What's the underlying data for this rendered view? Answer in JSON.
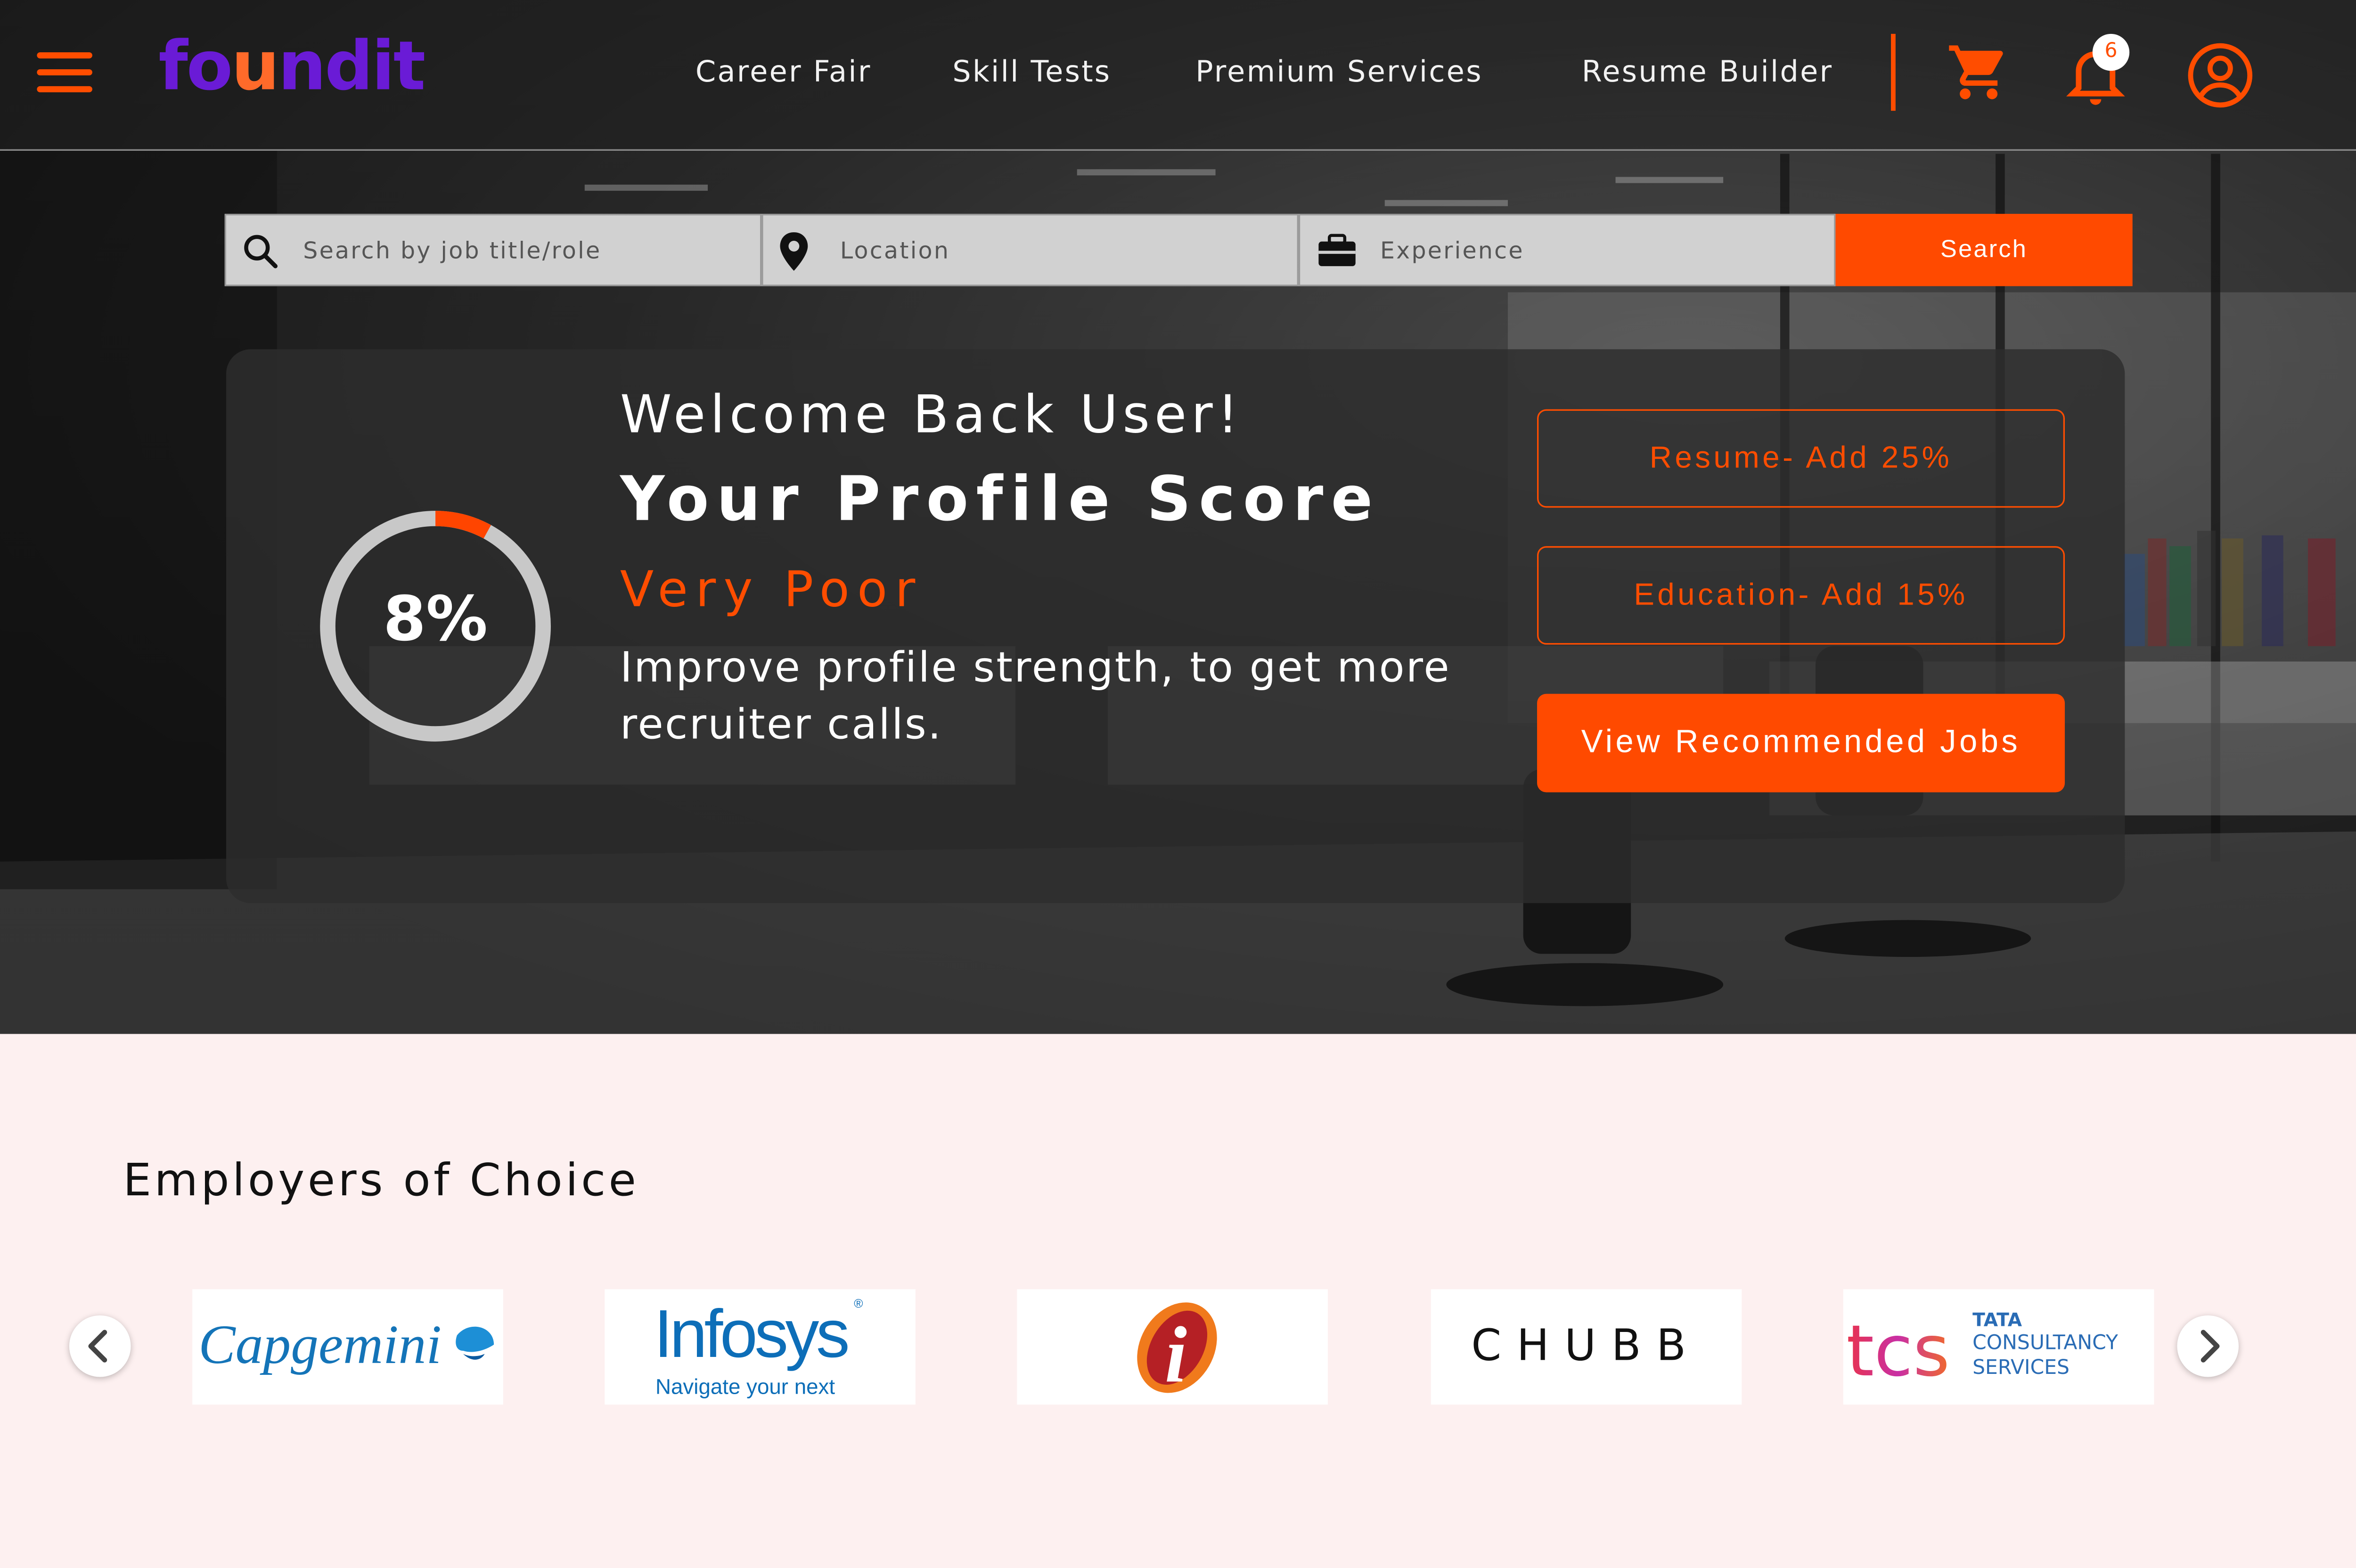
{
  "brand": {
    "logo_text": "foundit",
    "accent": "#ff4d00",
    "logo_color": "#6a1bd6"
  },
  "nav": {
    "items": [
      "Career Fair",
      "Skill Tests",
      "Premium Services",
      "Resume Builder"
    ],
    "notification_count": "6",
    "icons": [
      "hamburger-menu-icon",
      "cart-icon",
      "bell-icon",
      "user-profile-icon"
    ]
  },
  "search": {
    "job_placeholder": "Search by job title/role",
    "location_placeholder": "Location",
    "experience_placeholder": "Experience",
    "button_label": "Search"
  },
  "profile": {
    "welcome": "Welcome Back User!",
    "score_title": "Your Profile Score",
    "score_percent": 8,
    "score_label": "8%",
    "rating": "Very Poor",
    "message": "Improve profile strength, to get more recruiter calls.",
    "actions": [
      "Resume- Add 25%",
      "Education- Add 15%"
    ],
    "recommended_button": "View Recommended Jobs"
  },
  "employers": {
    "title": "Employers of Choice",
    "logos": [
      {
        "name": "Capgemini",
        "text": "Capgemini"
      },
      {
        "name": "Infosys",
        "text": "Infosys",
        "tagline": "Navigate your next"
      },
      {
        "name": "ICICI",
        "text": "i"
      },
      {
        "name": "Chubb",
        "text": "CHUBB"
      },
      {
        "name": "TCS",
        "text": "tcs",
        "sub": [
          "TATA",
          "CONSULTANCY",
          "SERVICES"
        ]
      }
    ]
  }
}
